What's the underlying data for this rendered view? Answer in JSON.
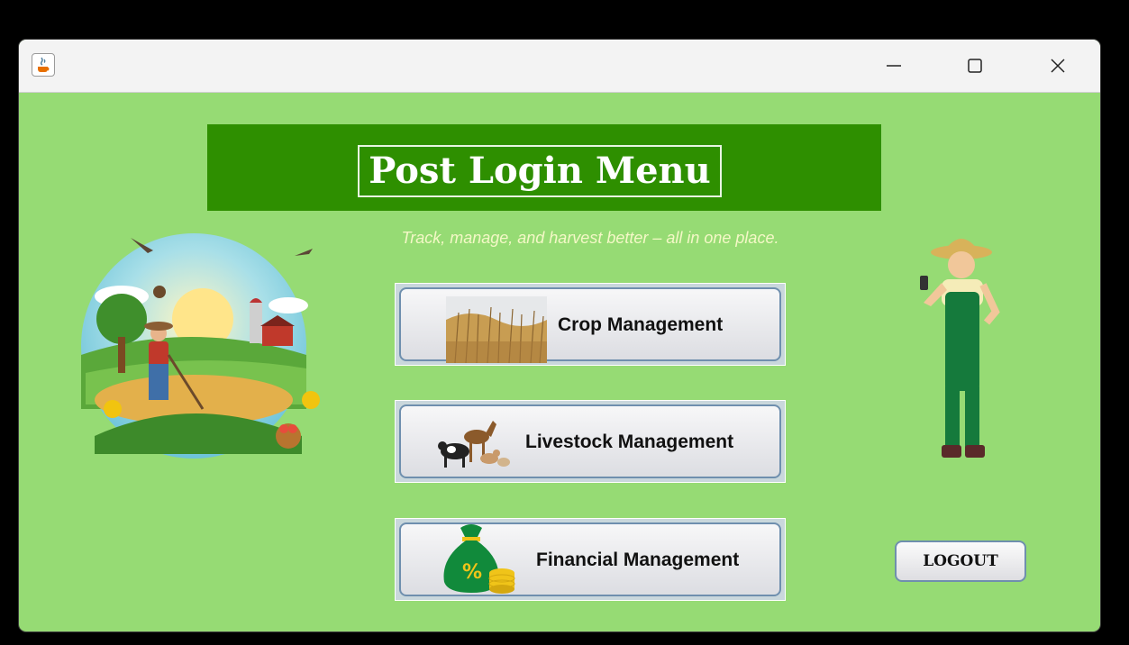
{
  "window": {
    "controls": {
      "minimize": "—",
      "maximize": "☐",
      "close": "✕"
    }
  },
  "header": {
    "title": "Post Login Menu",
    "subtitle": "Track, manage, and harvest better – all in one place."
  },
  "menu": {
    "crop_label": "Crop Management",
    "livestock_label": "Livestock Management",
    "financial_label": "Financial Management"
  },
  "logout_label": "LOGOUT",
  "colors": {
    "background": "#96db74",
    "banner": "#2e8f00",
    "subtitle": "#f4f8c6"
  },
  "icons": {
    "app": "java-coffee-icon",
    "crop": "wheat-field-icon",
    "livestock": "farm-animals-icon",
    "financial": "money-bag-icon"
  }
}
